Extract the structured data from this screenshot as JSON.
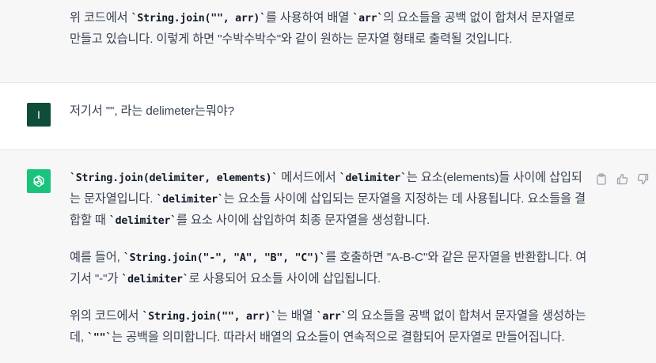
{
  "messages": {
    "assistant_prev": {
      "lines": [
        {
          "pre": "위 코드에서 ",
          "code": "`String.join(\"\", arr)`",
          "post": "를 사용하여 배열 ",
          "code2": "`arr`",
          "post2": "의 요소들을 공백 없이 합쳐서 문자열로"
        },
        {
          "text": "만들고 있습니다. 이렇게 하면 \"수박수박수\"와 같이 원하는 문자열 형태로 출력될 것입니다."
        }
      ]
    },
    "user": {
      "avatar_letter": "I",
      "text": "저기서 \"\", 라는 delimeter는뭐야?"
    },
    "assistant": {
      "p1": {
        "c1": "`String.join(delimiter, elements)`",
        "t1": " 메서드에서 ",
        "c2": "`delimiter`",
        "t2": "는 요소(elements)들 사이에 삽입되는 문자열입니다. ",
        "c3": "`delimiter`",
        "t3": "는 요소들 사이에 삽입되는 문자열을 지정하는 데 사용됩니다. 요소들을 결합할 때 ",
        "c4": "`delimiter`",
        "t4": "를 요소 사이에 삽입하여 최종 문자열을 생성합니다."
      },
      "p2": {
        "t1": "예를 들어, ",
        "c1": "`String.join(\"-\", \"A\", \"B\", \"C\")`",
        "t2": "를 호출하면 \"A-B-C\"와 같은 문자열을 반환합니다. 여기서 \"-\"가 ",
        "c2": "`delimiter`",
        "t3": "로 사용되어 요소들 사이에 삽입됩니다."
      },
      "p3": {
        "t1": "위의 코드에서 ",
        "c1": "`String.join(\"\", arr)`",
        "t2": "는 배열 ",
        "c2": "`arr`",
        "t3": "의 요소들을 공백 없이 합쳐서 문자열을 생성하는데, ",
        "c3": "`\"\"`",
        "t4": "는 공백을 의미합니다. 따라서 배열의 요소들이 연속적으로 결합되어 문자열로 만들어집니다."
      }
    }
  },
  "icons": {
    "copy": "clipboard-icon",
    "like": "thumbs-up-icon",
    "dislike": "thumbs-down-icon",
    "bot": "openai-logo-icon"
  },
  "colors": {
    "bot_avatar": "#19c37d",
    "user_avatar": "#0f4c3a",
    "assistant_bg": "#f7f7f8"
  }
}
